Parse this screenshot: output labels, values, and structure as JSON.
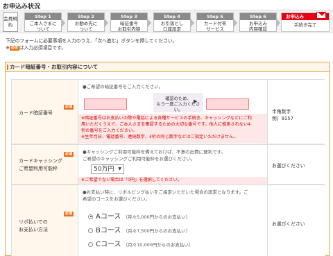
{
  "page": {
    "title": "お申込み状況"
  },
  "steps": {
    "first": "会員規約",
    "items": [
      {
        "num": "Step 1",
        "label1": "ご本人さまに",
        "label2": "ついて"
      },
      {
        "num": "Step 2",
        "label1": "お勤め先に",
        "label2": "ついて"
      },
      {
        "num": "Step 3",
        "label1": "暗証番号",
        "label2": "お取引内容"
      },
      {
        "num": "Step 4",
        "label1": "お引落とし",
        "label2": "口座設定"
      },
      {
        "num": "Step 5",
        "label1": "カード付帯",
        "label2": "サービス"
      },
      {
        "num": "Step 6",
        "label1": "お申込み",
        "label2": "内容確認"
      }
    ],
    "final": {
      "head": "お申込み",
      "label": "手続き完了"
    }
  },
  "intro": {
    "line1": "下記のフォームに必要事項を入力のうえ、「次へ進む」ボタンを押してください。",
    "line2_prefix": "※",
    "line2_suffix": "は入力必須項目です。",
    "required_badge": "必須"
  },
  "panel": {
    "title": "カード暗証番号・お取引内容について"
  },
  "pin": {
    "label": "カード暗証番号",
    "badge": "必須",
    "hint": "●ご希望の暗証番号をご入力ください。",
    "confirm1": "確認のため、",
    "confirm2": "もう一度ご入力ください。",
    "warn1": "※暗証番号はお支払いの際や電話による各種サービスの手続き、キャッシングなどにご利",
    "warn2": "用いただくうえで、ご本人さまを確認するための大切な番号です。他人に推測されない4",
    "warn3": "桁の番号をご入力ください。",
    "warn4": "※生年月日、電話番号、連続数字、4桁の同じ数字などはご指定いただけません。",
    "note1": "半角数字",
    "note2": "例）9157"
  },
  "cashing": {
    "label1": "カードキャッシング",
    "label2": "ご希望利用可能枠",
    "badge": "必須",
    "hint1": "●キャッシングご利用可能枠を備えておけば、不意の出費に便利です。",
    "hint2": "ご希望のキャッシングご利用可能枠をお選びください。",
    "selected": "50万円",
    "warn": "※ご希望でない場合は「0円」を選択してください。",
    "note": "お選びください"
  },
  "revolving": {
    "label1": "リボ払いでの",
    "label2": "お支払い方法",
    "badge": "必須",
    "hint1": "●お支払い時に、リボルビング払いをご指定いただいた場合の設定となります。ご",
    "hint2": "希望のコースをお選びください。",
    "note": "お選びください",
    "options": [
      {
        "name": "Aコース",
        "detail": "（月々5,000円からのお支払い）",
        "checked": true
      },
      {
        "name": "Bコース",
        "detail": "（月々7,500円からのお支払い）",
        "checked": false
      },
      {
        "name": "Cコース",
        "detail": "（月々10,000円からのお支払い）",
        "checked": false
      }
    ]
  }
}
